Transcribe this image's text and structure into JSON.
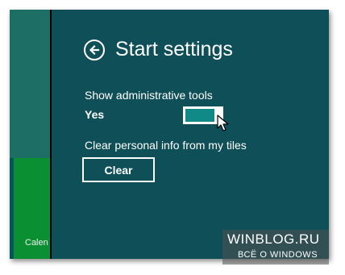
{
  "start_screen": {
    "tile_label": "Calen"
  },
  "settings": {
    "title": "Start settings",
    "admin_tools": {
      "label": "Show administrative tools",
      "state": "Yes",
      "on": true
    },
    "clear_info": {
      "label": "Clear personal info from my tiles",
      "button": "Clear"
    }
  },
  "watermark": {
    "line1": "WINBLOG.RU",
    "line2": "ВСЁ О WINDOWS"
  },
  "colors": {
    "panel": "#0f4f57",
    "accent": "#0f8a86",
    "tile": "#0a8f33"
  }
}
